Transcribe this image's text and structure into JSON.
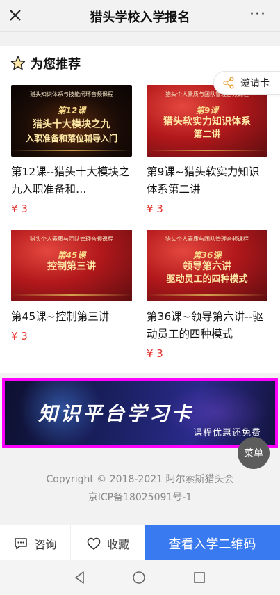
{
  "topbar": {
    "title": "猎头学校入学报名",
    "close_icon": "close-icon",
    "more_label": "···"
  },
  "section": {
    "title": "为您推荐",
    "icon": "star-icon"
  },
  "invite": {
    "label": "邀请卡",
    "icon": "share-icon"
  },
  "courses": [
    {
      "name": "第12课--猎头十大模块之九入职准备和…",
      "price": "¥ 3",
      "thumb": {
        "series": "猎头知识体系与技能闭环音频课程",
        "lesson": "第12课",
        "line1": "猎头十大模块之九",
        "line2": "入职准备和落位辅导入门",
        "style": "dark"
      }
    },
    {
      "name": "第9课~猎头软实力知识体系第二讲",
      "price": "¥ 3",
      "thumb": {
        "series": "猎头个人素质与团队管理音频课程",
        "lesson": "第9课",
        "line1": "猎头软实力知识体系",
        "line2": "第二讲",
        "style": "red"
      }
    },
    {
      "name": "第45课~控制第三讲",
      "price": "¥ 3",
      "thumb": {
        "series": "猎头个人素质与团队管理音频课程",
        "lesson": "第45课",
        "line1": "控制第三讲",
        "line2": "",
        "style": "red"
      }
    },
    {
      "name": "第36课~领导第六讲--驱动员工的四种模式",
      "price": "¥ 3",
      "thumb": {
        "series": "猎头个人素质与团队管理音频课程",
        "lesson": "第36课",
        "line1": "领导第六讲",
        "line2": "驱动员工的四种模式",
        "style": "red"
      }
    }
  ],
  "banner": {
    "title": "知识平台学习卡",
    "subtitle": "课程优惠还免费"
  },
  "menu_label": "菜单",
  "footer": {
    "copyright": "Copyright © 2018-2021 阿尔索斯猎头会",
    "icp": "京ICP备18025091号-1"
  },
  "bottom_bar": {
    "consult": "咨询",
    "favorite": "收藏",
    "qr_button": "查看入学二维码"
  },
  "colors": {
    "price": "#e5322d",
    "primary_button": "#3a7af0",
    "banner_highlight": "#ff00ff"
  }
}
